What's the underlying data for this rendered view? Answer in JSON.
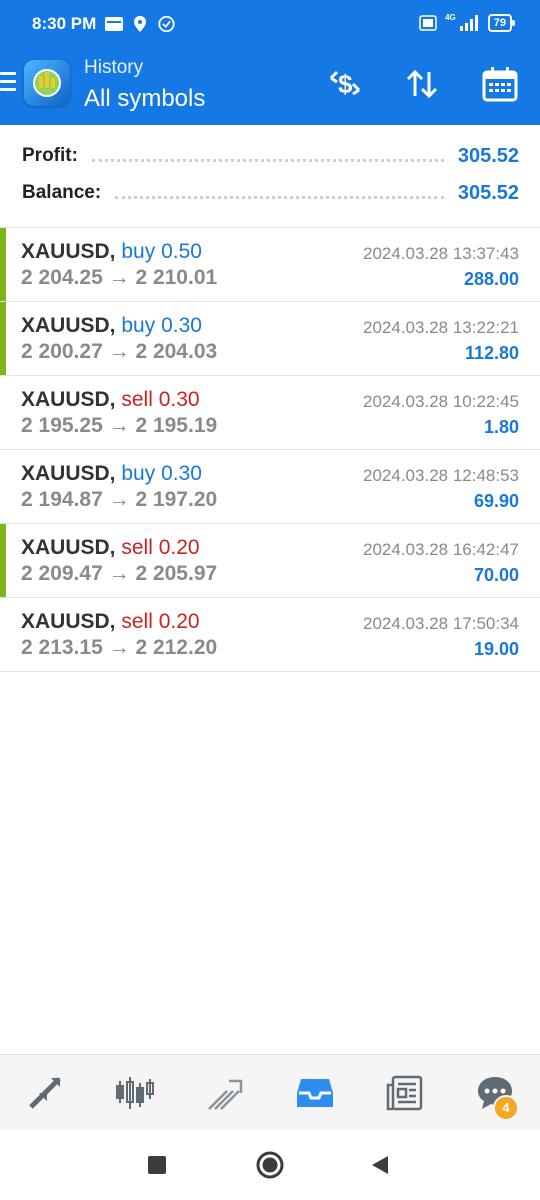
{
  "status_bar": {
    "time": "8:30 PM",
    "battery": "79",
    "network": "4G"
  },
  "header": {
    "subtitle": "History",
    "title": "All symbols"
  },
  "summary": {
    "profit_label": "Profit:",
    "profit_value": "305.52",
    "balance_label": "Balance:",
    "balance_value": "305.52"
  },
  "trades": [
    {
      "symbol": "XAUUSD,",
      "side": "buy",
      "volume": "0.50",
      "open": "2 204.25",
      "close": "2 210.01",
      "arrow": "→",
      "time": "2024.03.28 13:37:43",
      "profit": "288.00",
      "marked": true
    },
    {
      "symbol": "XAUUSD,",
      "side": "buy",
      "volume": "0.30",
      "open": "2 200.27",
      "close": "2 204.03",
      "arrow": "→",
      "time": "2024.03.28 13:22:21",
      "profit": "112.80",
      "marked": true
    },
    {
      "symbol": "XAUUSD,",
      "side": "sell",
      "volume": "0.30",
      "open": "2 195.25",
      "close": "2 195.19",
      "arrow": "→",
      "time": "2024.03.28 10:22:45",
      "profit": "1.80",
      "marked": false
    },
    {
      "symbol": "XAUUSD,",
      "side": "buy",
      "volume": "0.30",
      "open": "2 194.87",
      "close": "2 197.20",
      "arrow": "→",
      "time": "2024.03.28 12:48:53",
      "profit": "69.90",
      "marked": false
    },
    {
      "symbol": "XAUUSD,",
      "side": "sell",
      "volume": "0.20",
      "open": "2 209.47",
      "close": "2 205.97",
      "arrow": "→",
      "time": "2024.03.28 16:42:47",
      "profit": "70.00",
      "marked": true
    },
    {
      "symbol": "XAUUSD,",
      "side": "sell",
      "volume": "0.20",
      "open": "2 213.15",
      "close": "2 212.20",
      "arrow": "→",
      "time": "2024.03.28 17:50:34",
      "profit": "19.00",
      "marked": false
    }
  ],
  "bottom_nav": {
    "items": [
      {
        "icon": "quotes-arrows-icon",
        "active": false
      },
      {
        "icon": "candlestick-chart-icon",
        "active": false
      },
      {
        "icon": "trade-icon",
        "active": false
      },
      {
        "icon": "history-inbox-icon",
        "active": true
      },
      {
        "icon": "news-icon",
        "active": false
      },
      {
        "icon": "chat-icon",
        "active": false
      }
    ],
    "chat_badge": "4"
  },
  "colors": {
    "primary": "#1479e4",
    "buy": "#1a78d6",
    "sell": "#cc2222",
    "marker": "#7cb518",
    "badge": "#f5a623"
  }
}
